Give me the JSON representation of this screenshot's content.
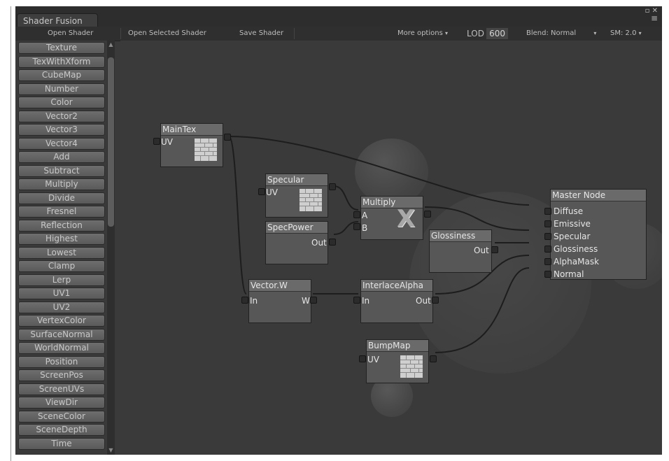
{
  "window": {
    "tab_title": "Shader Fusion",
    "controls_text": "▫ ✕",
    "menu_icon": "≡"
  },
  "toolbar": {
    "open_shader": "Open Shader",
    "open_selected": "Open Selected Shader",
    "save_shader": "Save Shader",
    "more_options": "More options",
    "lod_label": "LOD",
    "lod_value": "600",
    "blend": "Blend: Normal",
    "sm": "SM: 2.0"
  },
  "palette": [
    "Texture",
    "TexWithXform",
    "CubeMap",
    "Number",
    "Color",
    "Vector2",
    "Vector3",
    "Vector4",
    "Add",
    "Subtract",
    "Multiply",
    "Divide",
    "Fresnel",
    "Reflection",
    "Highest",
    "Lowest",
    "Clamp",
    "Lerp",
    "UV1",
    "UV2",
    "VertexColor",
    "SurfaceNormal",
    "WorldNormal",
    "Position",
    "ScreenPos",
    "ScreenUVs",
    "ViewDir",
    "SceneColor",
    "SceneDepth",
    "Time"
  ],
  "nodes": {
    "maintex": {
      "title": "MainTex",
      "input": "UV"
    },
    "specular": {
      "title": "Specular",
      "input": "UV"
    },
    "specpower": {
      "title": "SpecPower",
      "output": "Out"
    },
    "multiply": {
      "title": "Multiply",
      "input_a": "A",
      "input_b": "B",
      "symbol": "X"
    },
    "glossiness": {
      "title": "Glossiness",
      "output": "Out"
    },
    "vectorw": {
      "title": "Vector.W",
      "input": "In",
      "output": "W"
    },
    "interlace": {
      "title": "InterlaceAlpha",
      "input": "In",
      "output": "Out"
    },
    "bumpmap": {
      "title": "BumpMap",
      "input": "UV"
    },
    "master": {
      "title": "Master Node",
      "inputs": [
        "Diffuse",
        "Emissive",
        "Specular",
        "Glossiness",
        "AlphaMask",
        "Normal"
      ]
    }
  },
  "icons": {
    "texture": "brick-texture-icon",
    "multiply": "x-icon"
  }
}
